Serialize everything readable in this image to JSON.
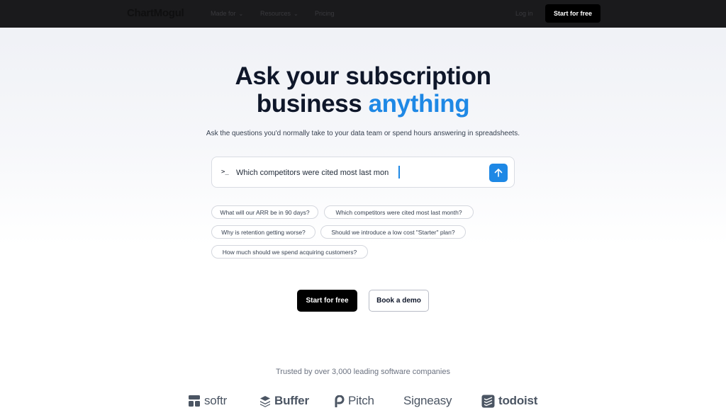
{
  "nav": {
    "brand": "ChartMogul",
    "links": [
      {
        "label": "Made for",
        "has_dropdown": true
      },
      {
        "label": "Resources",
        "has_dropdown": true
      },
      {
        "label": "Pricing",
        "has_dropdown": false
      }
    ],
    "login": "Log in",
    "cta": "Start for free"
  },
  "hero": {
    "title_line1": "Ask your subscription",
    "title_line2_prefix": "business ",
    "title_accent": "anything",
    "accent_color": "#1e88e5",
    "subtitle": "Ask the questions you'd normally take to your data team or spend hours answering in spreadsheets."
  },
  "prompt": {
    "glyph": ">_",
    "value": "Which competitors were cited most last mon",
    "send_icon": "arrow-up-icon"
  },
  "suggestions": [
    "What will our ARR be in 90 days?",
    "Which competitors were cited most last month?",
    "Why is retention getting worse?",
    "Should we introduce a low cost \"Starter\" plan?",
    "How much should we spend acquiring customers?"
  ],
  "actions": {
    "primary": "Start for free",
    "secondary": "Book a demo"
  },
  "trusted": {
    "text": "Trusted by over 3,000 leading software companies",
    "logos": [
      "softr",
      "Buffer",
      "Pitch",
      "Signeasy",
      "todoist"
    ]
  }
}
